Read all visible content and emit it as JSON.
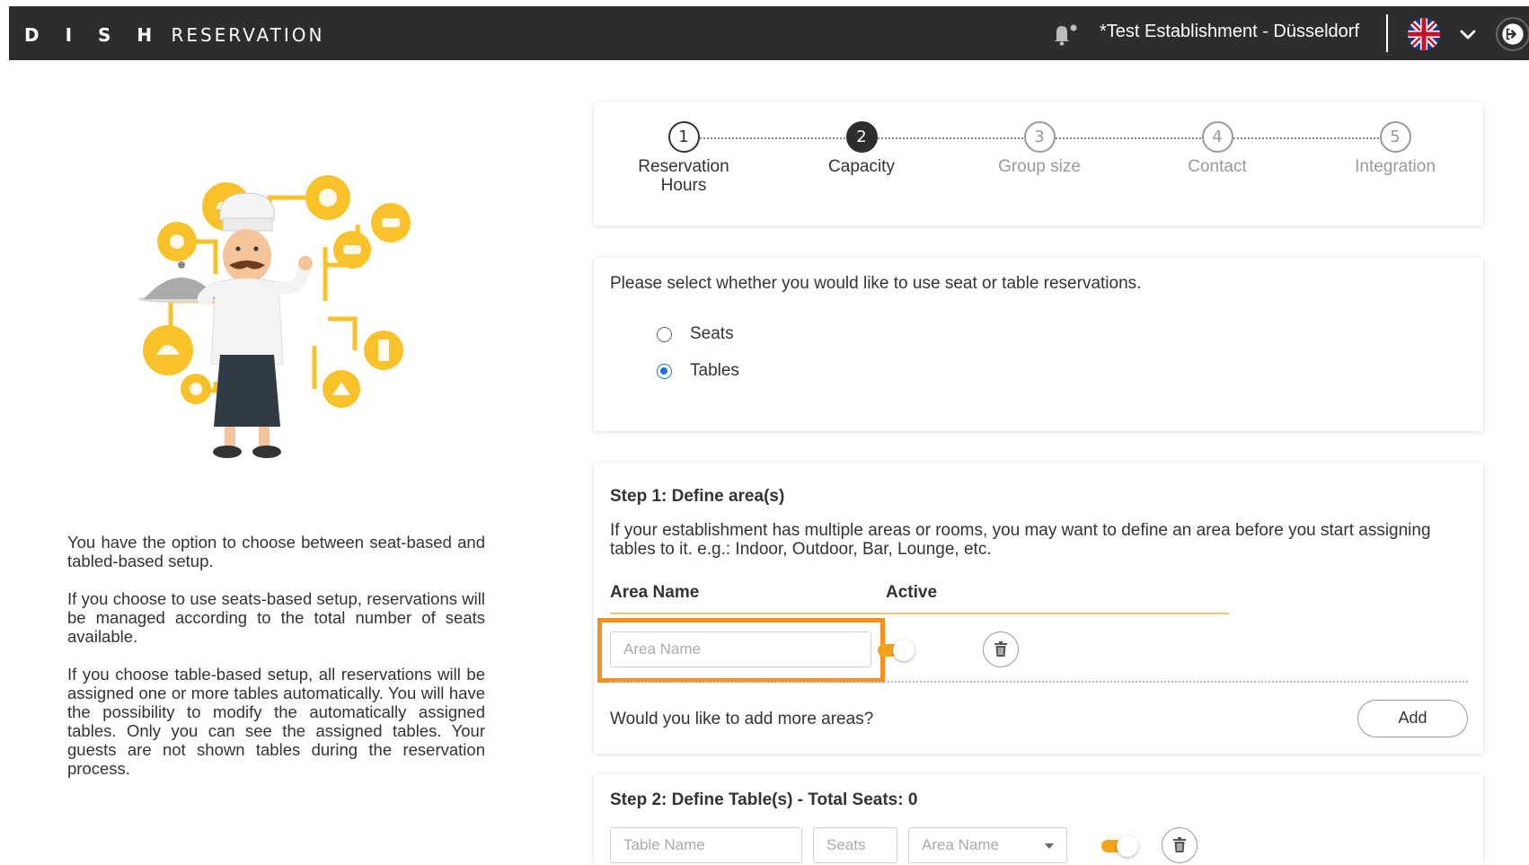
{
  "header": {
    "logo_bold": "D I S H",
    "logo_light": "RESERVATION",
    "establishment": "*Test Establishment - Düsseldorf",
    "icons": [
      "bell-icon",
      "uk-flag-icon",
      "chevron-down-icon",
      "logout-icon"
    ]
  },
  "sidebar": {
    "paragraphs": [
      "You have the option to choose between seat-based and tabled-based setup.",
      "If you choose to use seats-based setup, reservations will be managed according to the total number of seats available.",
      "If you choose table-based setup, all reservations will be assigned one or more tables automatically. You will have the possibility to modify the automatically assigned tables. Only you can see the assigned tables. Your guests are not shown tables during the reservation process."
    ]
  },
  "stepper": {
    "steps": [
      {
        "number": "1",
        "label": "Reservation Hours",
        "state": "done"
      },
      {
        "number": "2",
        "label": "Capacity",
        "state": "active"
      },
      {
        "number": "3",
        "label": "Group size",
        "state": "todo"
      },
      {
        "number": "4",
        "label": "Contact",
        "state": "todo"
      },
      {
        "number": "5",
        "label": "Integration",
        "state": "todo"
      }
    ]
  },
  "reservation_type": {
    "question": "Please select whether you would like to use seat or table reservations.",
    "options": [
      {
        "label": "Seats",
        "selected": false
      },
      {
        "label": "Tables",
        "selected": true
      }
    ]
  },
  "areas": {
    "title": "Step 1: Define area(s)",
    "description": "If your establishment has multiple areas or rooms, you may want to define an area before you start assigning tables to it. e.g.: Indoor, Outdoor, Bar, Lounge, etc.",
    "col_area_name": "Area Name",
    "col_active": "Active",
    "area_name_placeholder": "Area Name",
    "active": true,
    "more_question": "Would you like to add more areas?",
    "add_label": "Add"
  },
  "tables": {
    "title": "Step 2: Define Table(s) - Total Seats: 0",
    "table_name_placeholder": "Table Name",
    "seats_placeholder": "Seats",
    "area_select_value": "Area Name",
    "active": true
  },
  "colors": {
    "header_bg": "#2d2d2d",
    "accent_orange": "#f7901e",
    "toggle_orange": "#f7a21b",
    "radio_blue": "#1a73e8"
  }
}
